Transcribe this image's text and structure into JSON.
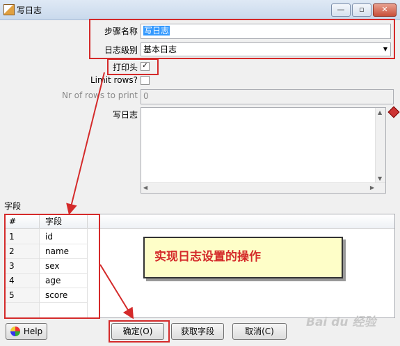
{
  "window": {
    "title": "写日志",
    "minimize": "—",
    "maximize": "▫",
    "close": "✕"
  },
  "form": {
    "step_name_label": "步骤名称",
    "step_name_value": "写日志",
    "log_level_label": "日志级别",
    "log_level_value": "基本日志",
    "print_header_label": "打印头",
    "print_header_checked": "✓",
    "limit_rows_label": "Limit rows?",
    "nr_rows_label": "Nr of rows to print",
    "nr_rows_value": "0",
    "write_log_label": "写日志",
    "write_log_value": ""
  },
  "fields": {
    "section_label": "字段",
    "columns": [
      "#",
      "字段"
    ],
    "rows": [
      {
        "num": "1",
        "name": "id"
      },
      {
        "num": "2",
        "name": "name"
      },
      {
        "num": "3",
        "name": "sex"
      },
      {
        "num": "4",
        "name": "age"
      },
      {
        "num": "5",
        "name": "score"
      }
    ]
  },
  "annotation": {
    "callout_text": "实现日志设置的操作"
  },
  "buttons": {
    "help": "Help",
    "ok": "确定(O)",
    "get_fields": "获取字段",
    "cancel": "取消(C)"
  },
  "watermark": "Bai du 经验"
}
